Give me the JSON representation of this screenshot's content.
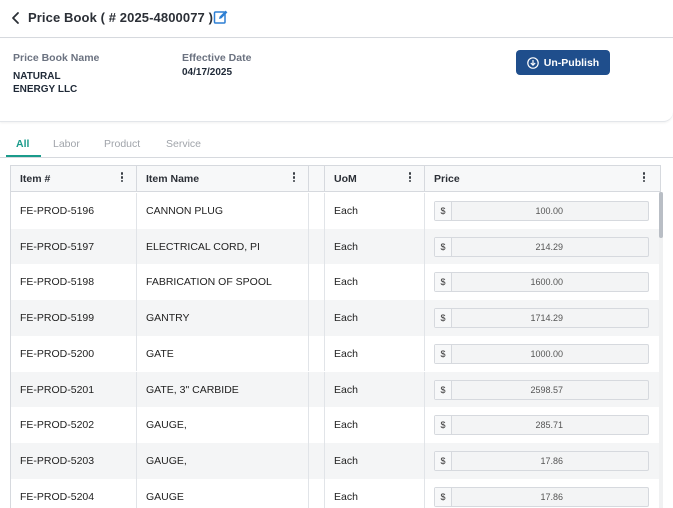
{
  "header": {
    "title": "Price Book ( # 2025-4800077 )"
  },
  "info": {
    "name_label": "Price Book Name",
    "name_line1": "NATURAL",
    "name_line2": "ENERGY LLC",
    "date_label": "Effective Date",
    "date_value": "04/17/2025",
    "unpublish_label": "Un-Publish"
  },
  "tabs": [
    {
      "label": "All",
      "active": true
    },
    {
      "label": "Labor",
      "active": false
    },
    {
      "label": "Product",
      "active": false
    },
    {
      "label": "Service",
      "active": false
    }
  ],
  "table": {
    "columns": [
      "Item #",
      "Item Name",
      "UoM",
      "Price"
    ],
    "currency_symbol": "$",
    "rows": [
      {
        "item": "FE-PROD-5196",
        "name": "CANNON PLUG",
        "uom": "Each",
        "price": "100.00"
      },
      {
        "item": "FE-PROD-5197",
        "name": "ELECTRICAL CORD, PI",
        "uom": "Each",
        "price": "214.29"
      },
      {
        "item": "FE-PROD-5198",
        "name": "FABRICATION OF SPOOL",
        "uom": "Each",
        "price": "1600.00"
      },
      {
        "item": "FE-PROD-5199",
        "name": "GANTRY",
        "uom": "Each",
        "price": "1714.29"
      },
      {
        "item": "FE-PROD-5200",
        "name": "GATE",
        "uom": "Each",
        "price": "1000.00"
      },
      {
        "item": "FE-PROD-5201",
        "name": "GATE, 3\" CARBIDE",
        "uom": "Each",
        "price": "2598.57"
      },
      {
        "item": "FE-PROD-5202",
        "name": "GAUGE,",
        "uom": "Each",
        "price": "285.71"
      },
      {
        "item": "FE-PROD-5203",
        "name": "GAUGE,",
        "uom": "Each",
        "price": "17.86"
      },
      {
        "item": "FE-PROD-5204",
        "name": "GAUGE",
        "uom": "Each",
        "price": "17.86"
      }
    ]
  },
  "colors": {
    "accent": "#1a9b8b",
    "button": "#1f4e8c",
    "edit_icon": "#2d7fd3"
  }
}
